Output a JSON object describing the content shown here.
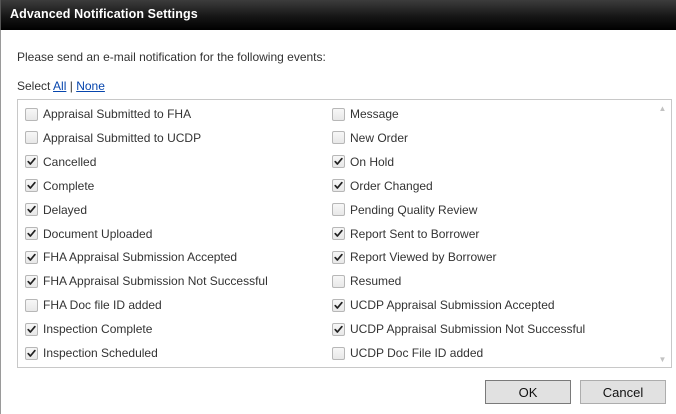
{
  "dialog": {
    "title": "Advanced Notification Settings",
    "intro": "Please send an e-mail notification for the following events:",
    "select_label": "Select",
    "select_all": "All",
    "select_separator": "|",
    "select_none": "None",
    "left_items": [
      {
        "label": "Appraisal Submitted to FHA",
        "checked": false
      },
      {
        "label": "Appraisal Submitted to UCDP",
        "checked": false
      },
      {
        "label": "Cancelled",
        "checked": true
      },
      {
        "label": "Complete",
        "checked": true
      },
      {
        "label": "Delayed",
        "checked": true
      },
      {
        "label": "Document Uploaded",
        "checked": true
      },
      {
        "label": "FHA Appraisal Submission Accepted",
        "checked": true
      },
      {
        "label": "FHA Appraisal Submission Not Successful",
        "checked": true
      },
      {
        "label": "FHA Doc file ID added",
        "checked": false
      },
      {
        "label": "Inspection Complete",
        "checked": true
      },
      {
        "label": "Inspection Scheduled",
        "checked": true
      }
    ],
    "right_items": [
      {
        "label": "Message",
        "checked": false
      },
      {
        "label": "New Order",
        "checked": false
      },
      {
        "label": "On Hold",
        "checked": true
      },
      {
        "label": "Order Changed",
        "checked": true
      },
      {
        "label": "Pending Quality Review",
        "checked": false
      },
      {
        "label": "Report Sent to Borrower",
        "checked": true
      },
      {
        "label": "Report Viewed by Borrower",
        "checked": true
      },
      {
        "label": "Resumed",
        "checked": false
      },
      {
        "label": "UCDP Appraisal Submission Accepted",
        "checked": true
      },
      {
        "label": "UCDP Appraisal Submission Not Successful",
        "checked": true
      },
      {
        "label": "UCDP Doc File ID added",
        "checked": false
      }
    ],
    "ok_label": "OK",
    "cancel_label": "Cancel"
  }
}
